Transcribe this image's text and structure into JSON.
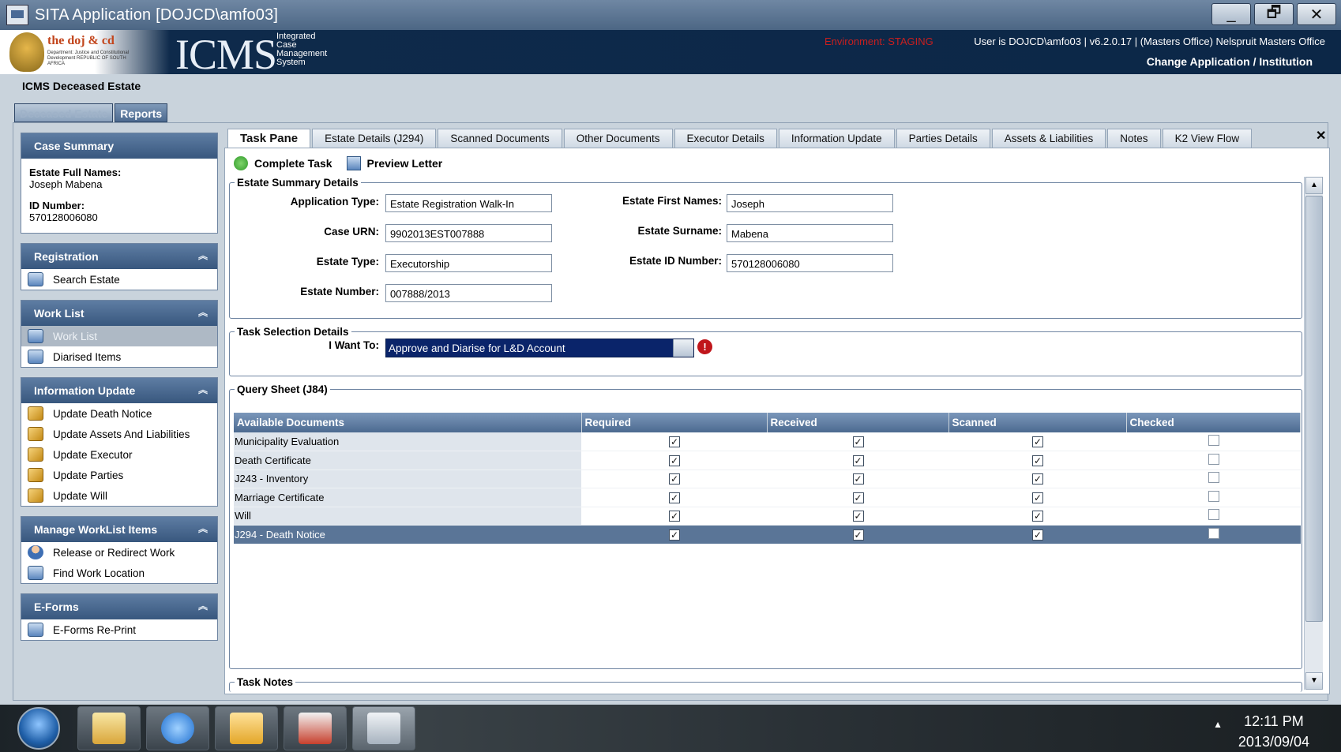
{
  "window": {
    "title": "SITA Application [DOJCD\\amfo03]",
    "minimize": "_",
    "restore": "🗗",
    "close": "✕"
  },
  "header": {
    "doj_logo": "the doj & cd",
    "doj_sub": "Department: Justice and Constitutional Development REPUBLIC OF SOUTH AFRICA",
    "icms": "ICMS",
    "icms_sub": [
      "Integrated",
      "Case",
      "Management",
      "System"
    ],
    "environment": "Environment: STAGING",
    "user_info": "User is DOJCD\\amfo03 | v6.2.0.17 | (Masters Office) Nelspruit Masters Office",
    "change_app": "Change Application / Institution"
  },
  "app_title": "ICMS Deceased Estate",
  "top_tabs": [
    "Deceased Estate",
    "Reports"
  ],
  "sidebar": {
    "case_summary": {
      "title": "Case Summary",
      "estate_names_label": "Estate Full Names:",
      "estate_names": "Joseph Mabena",
      "id_label": "ID Number:",
      "id_value": "570128006080"
    },
    "groups": [
      {
        "title": "Registration",
        "items": [
          "Search Estate"
        ]
      },
      {
        "title": "Work List",
        "items": [
          "Work List",
          "Diarised Items"
        ]
      },
      {
        "title": "Information Update",
        "items": [
          "Update Death Notice",
          "Update Assets And Liabilities",
          "Update Executor",
          "Update Parties",
          "Update Will"
        ]
      },
      {
        "title": "Manage WorkList Items",
        "items": [
          "Release or Redirect Work",
          "Find Work Location"
        ]
      },
      {
        "title": "E-Forms",
        "items": [
          "E-Forms Re-Print"
        ]
      }
    ]
  },
  "content_tabs": [
    "Task Pane",
    "Estate Details (J294)",
    "Scanned Documents",
    "Other Documents",
    "Executor Details",
    "Information Update",
    "Parties Details",
    "Assets & Liabilities",
    "Notes",
    "K2 View Flow"
  ],
  "toolbar": {
    "complete": "Complete Task",
    "preview": "Preview Letter"
  },
  "estate_summary": {
    "legend": "Estate Summary Details",
    "application_type_label": "Application Type:",
    "application_type": "Estate Registration Walk-In",
    "case_urn_label": "Case URN:",
    "case_urn": "9902013EST007888",
    "estate_type_label": "Estate Type:",
    "estate_type": "Executorship",
    "estate_number_label": "Estate Number:",
    "estate_number": "007888/2013",
    "first_names_label": "Estate First Names:",
    "first_names": "Joseph",
    "surname_label": "Estate Surname:",
    "surname": "Mabena",
    "id_label": "Estate ID Number:",
    "id_number": "570128006080"
  },
  "task_selection": {
    "legend": "Task Selection Details",
    "want_label": "I Want To:",
    "selected": "Approve and Diarise for L&D Account"
  },
  "query_sheet": {
    "legend": "Query Sheet (J84)",
    "columns": [
      "Available Documents",
      "Required",
      "Received",
      "Scanned",
      "Checked"
    ],
    "rows": [
      {
        "name": "Municipality Evaluation",
        "required": true,
        "received": true,
        "scanned": true,
        "checked": false
      },
      {
        "name": "Death Certificate",
        "required": true,
        "received": true,
        "scanned": true,
        "checked": false
      },
      {
        "name": "J243 - Inventory",
        "required": true,
        "received": true,
        "scanned": true,
        "checked": false
      },
      {
        "name": "Marriage Certificate",
        "required": true,
        "received": true,
        "scanned": true,
        "checked": false
      },
      {
        "name": "Will",
        "required": true,
        "received": true,
        "scanned": true,
        "checked": false
      },
      {
        "name": "J294 - Death Notice",
        "required": true,
        "received": true,
        "scanned": true,
        "checked": false
      }
    ]
  },
  "task_notes": {
    "legend": "Task Notes"
  },
  "taskbar": {
    "time": "12:11 PM",
    "date": "2013/09/04"
  }
}
